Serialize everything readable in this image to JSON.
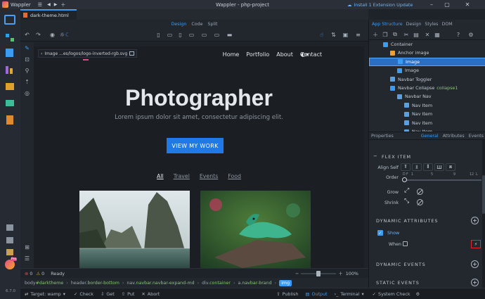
{
  "app": {
    "name": "Wappler",
    "window_title": "Wappler - php-project",
    "extension_update": "Install 1 Extension Update",
    "version": "6.7.0"
  },
  "colors": {
    "accent": "#3b9cf2",
    "cta": "#1f7ae8",
    "class_green": "#84c66a",
    "error_red": "#e04848"
  },
  "editor": {
    "tab_label": "dark-theme.html",
    "view_modes": [
      "Design",
      "Code",
      "Split"
    ],
    "active_view": "Design"
  },
  "canvas": {
    "breadcrumb_chip": "Image ...es/logos/logo-inverted-rgb.svg",
    "nav_links": [
      "Home",
      "Portfolio",
      "About",
      "Contact"
    ],
    "hero_title": "Photographer",
    "hero_subtitle": "Lorem ipsum dolor sit amet, consectetur adipiscing elit.",
    "cta_label": "VIEW MY WORK",
    "filters": [
      "All",
      "Travel",
      "Events",
      "Food"
    ],
    "active_filter": "All"
  },
  "status": {
    "errors": "0",
    "warnings": "0",
    "state": "Ready",
    "zoom": "100%"
  },
  "path": [
    {
      "tag": "body",
      "cls": "#darktheme"
    },
    {
      "tag": "header",
      "cls": ".border-bottom"
    },
    {
      "tag": "nav",
      "cls": ".navbar.navbar-expand-md"
    },
    {
      "tag": "div",
      "cls": ".container"
    },
    {
      "tag": "a",
      "cls": ".navbar-brand"
    },
    {
      "tag": "img",
      "cls": ""
    }
  ],
  "bottom": {
    "target_label": "Target: wamp",
    "check": "Check",
    "get": "Get",
    "put": "Put",
    "abort": "Abort",
    "publish": "Publish",
    "output": "Output",
    "terminal": "Terminal",
    "system_check": "System Check"
  },
  "right_panel": {
    "tabs": [
      "App Structure",
      "Design",
      "Styles",
      "DOM"
    ],
    "tree": [
      {
        "label": "Container",
        "cls": "",
        "indent": 0
      },
      {
        "label": "Anchor image",
        "cls": "",
        "indent": 1
      },
      {
        "label": "Image",
        "cls": "",
        "indent": 2,
        "selected": true
      },
      {
        "label": "Image",
        "cls": "",
        "indent": 2
      },
      {
        "label": "Navbar Toggler",
        "cls": "",
        "indent": 1
      },
      {
        "label": "Navbar Collapse",
        "cls": "collapse1",
        "indent": 1
      },
      {
        "label": "Navbar Nav",
        "cls": "",
        "indent": 2
      },
      {
        "label": "Nav Item",
        "cls": "",
        "indent": 3
      },
      {
        "label": "Nav Item",
        "cls": "",
        "indent": 3
      },
      {
        "label": "Nav Item",
        "cls": "",
        "indent": 3
      },
      {
        "label": "Nav Item",
        "cls": "",
        "indent": 3
      }
    ],
    "prop_header": "Properties",
    "prop_tabs": [
      "General",
      "Attributes",
      "Events"
    ],
    "flex_item_title": "FLEX ITEM",
    "align_self_label": "Align Self",
    "order_label": "Order",
    "order_ticks": [
      "D",
      "F",
      "1",
      "5",
      "9",
      "12",
      "L"
    ],
    "grow_label": "Grow",
    "shrink_label": "Shrink",
    "dynamic_attributes_title": "DYNAMIC ATTRIBUTES",
    "show_label": "Show",
    "when_label": "When",
    "dynamic_events_title": "DYNAMIC EVENTS",
    "static_events_title": "STATIC EVENTS"
  }
}
